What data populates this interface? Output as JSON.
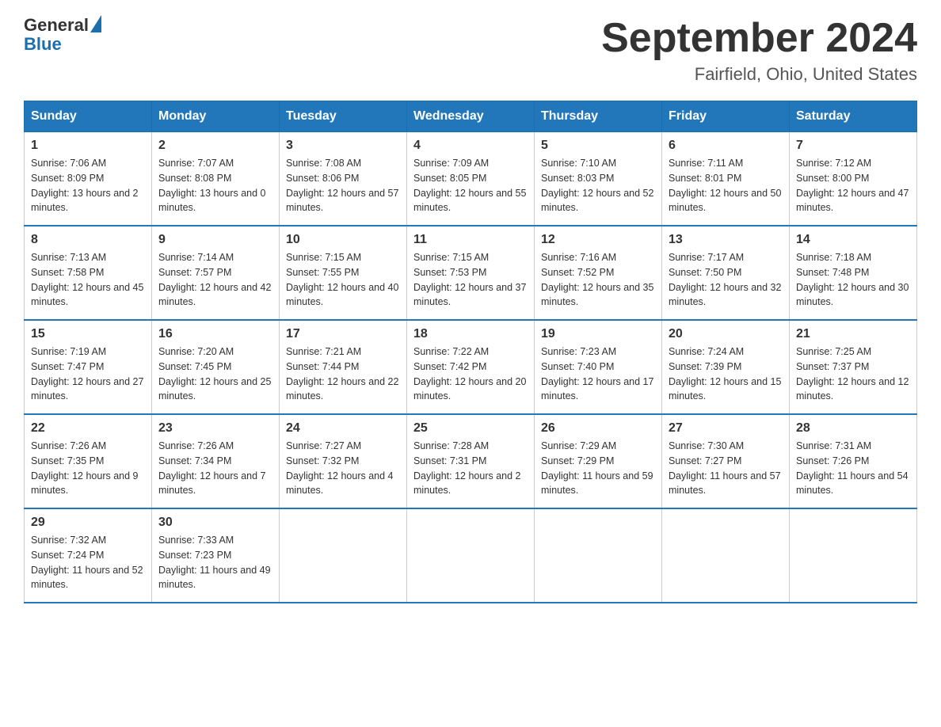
{
  "header": {
    "logo_general": "General",
    "logo_blue": "Blue",
    "month_title": "September 2024",
    "location": "Fairfield, Ohio, United States"
  },
  "days_of_week": [
    "Sunday",
    "Monday",
    "Tuesday",
    "Wednesday",
    "Thursday",
    "Friday",
    "Saturday"
  ],
  "weeks": [
    [
      {
        "day": "1",
        "sunrise": "7:06 AM",
        "sunset": "8:09 PM",
        "daylight": "13 hours and 2 minutes."
      },
      {
        "day": "2",
        "sunrise": "7:07 AM",
        "sunset": "8:08 PM",
        "daylight": "13 hours and 0 minutes."
      },
      {
        "day": "3",
        "sunrise": "7:08 AM",
        "sunset": "8:06 PM",
        "daylight": "12 hours and 57 minutes."
      },
      {
        "day": "4",
        "sunrise": "7:09 AM",
        "sunset": "8:05 PM",
        "daylight": "12 hours and 55 minutes."
      },
      {
        "day": "5",
        "sunrise": "7:10 AM",
        "sunset": "8:03 PM",
        "daylight": "12 hours and 52 minutes."
      },
      {
        "day": "6",
        "sunrise": "7:11 AM",
        "sunset": "8:01 PM",
        "daylight": "12 hours and 50 minutes."
      },
      {
        "day": "7",
        "sunrise": "7:12 AM",
        "sunset": "8:00 PM",
        "daylight": "12 hours and 47 minutes."
      }
    ],
    [
      {
        "day": "8",
        "sunrise": "7:13 AM",
        "sunset": "7:58 PM",
        "daylight": "12 hours and 45 minutes."
      },
      {
        "day": "9",
        "sunrise": "7:14 AM",
        "sunset": "7:57 PM",
        "daylight": "12 hours and 42 minutes."
      },
      {
        "day": "10",
        "sunrise": "7:15 AM",
        "sunset": "7:55 PM",
        "daylight": "12 hours and 40 minutes."
      },
      {
        "day": "11",
        "sunrise": "7:15 AM",
        "sunset": "7:53 PM",
        "daylight": "12 hours and 37 minutes."
      },
      {
        "day": "12",
        "sunrise": "7:16 AM",
        "sunset": "7:52 PM",
        "daylight": "12 hours and 35 minutes."
      },
      {
        "day": "13",
        "sunrise": "7:17 AM",
        "sunset": "7:50 PM",
        "daylight": "12 hours and 32 minutes."
      },
      {
        "day": "14",
        "sunrise": "7:18 AM",
        "sunset": "7:48 PM",
        "daylight": "12 hours and 30 minutes."
      }
    ],
    [
      {
        "day": "15",
        "sunrise": "7:19 AM",
        "sunset": "7:47 PM",
        "daylight": "12 hours and 27 minutes."
      },
      {
        "day": "16",
        "sunrise": "7:20 AM",
        "sunset": "7:45 PM",
        "daylight": "12 hours and 25 minutes."
      },
      {
        "day": "17",
        "sunrise": "7:21 AM",
        "sunset": "7:44 PM",
        "daylight": "12 hours and 22 minutes."
      },
      {
        "day": "18",
        "sunrise": "7:22 AM",
        "sunset": "7:42 PM",
        "daylight": "12 hours and 20 minutes."
      },
      {
        "day": "19",
        "sunrise": "7:23 AM",
        "sunset": "7:40 PM",
        "daylight": "12 hours and 17 minutes."
      },
      {
        "day": "20",
        "sunrise": "7:24 AM",
        "sunset": "7:39 PM",
        "daylight": "12 hours and 15 minutes."
      },
      {
        "day": "21",
        "sunrise": "7:25 AM",
        "sunset": "7:37 PM",
        "daylight": "12 hours and 12 minutes."
      }
    ],
    [
      {
        "day": "22",
        "sunrise": "7:26 AM",
        "sunset": "7:35 PM",
        "daylight": "12 hours and 9 minutes."
      },
      {
        "day": "23",
        "sunrise": "7:26 AM",
        "sunset": "7:34 PM",
        "daylight": "12 hours and 7 minutes."
      },
      {
        "day": "24",
        "sunrise": "7:27 AM",
        "sunset": "7:32 PM",
        "daylight": "12 hours and 4 minutes."
      },
      {
        "day": "25",
        "sunrise": "7:28 AM",
        "sunset": "7:31 PM",
        "daylight": "12 hours and 2 minutes."
      },
      {
        "day": "26",
        "sunrise": "7:29 AM",
        "sunset": "7:29 PM",
        "daylight": "11 hours and 59 minutes."
      },
      {
        "day": "27",
        "sunrise": "7:30 AM",
        "sunset": "7:27 PM",
        "daylight": "11 hours and 57 minutes."
      },
      {
        "day": "28",
        "sunrise": "7:31 AM",
        "sunset": "7:26 PM",
        "daylight": "11 hours and 54 minutes."
      }
    ],
    [
      {
        "day": "29",
        "sunrise": "7:32 AM",
        "sunset": "7:24 PM",
        "daylight": "11 hours and 52 minutes."
      },
      {
        "day": "30",
        "sunrise": "7:33 AM",
        "sunset": "7:23 PM",
        "daylight": "11 hours and 49 minutes."
      },
      null,
      null,
      null,
      null,
      null
    ]
  ]
}
